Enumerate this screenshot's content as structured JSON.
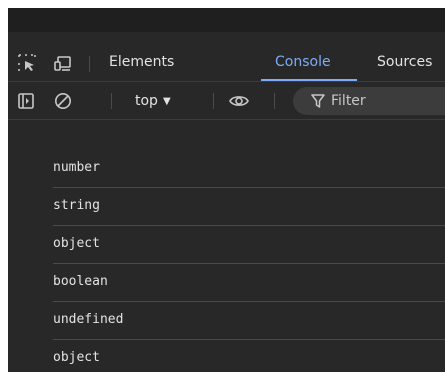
{
  "tabbar": {
    "tabs": [
      {
        "label": "Elements"
      },
      {
        "label": "Console"
      },
      {
        "label": "Sources"
      }
    ],
    "active_tab": "Console",
    "icons": [
      "inspect-element-icon",
      "device-toolbar-icon"
    ]
  },
  "toolbar": {
    "icons": [
      "sidebar-toggle-icon",
      "clear-console-icon",
      "eye-icon",
      "filter-icon"
    ],
    "context": "top",
    "filter_placeholder": "Filter"
  },
  "console": {
    "messages": [
      {
        "text": "number"
      },
      {
        "text": "string"
      },
      {
        "text": "object"
      },
      {
        "text": "boolean"
      },
      {
        "text": "undefined"
      },
      {
        "text": "object"
      }
    ]
  },
  "colors": {
    "background": "#282828",
    "active_tab": "#7cacf8",
    "text": "#e3e3e3"
  }
}
